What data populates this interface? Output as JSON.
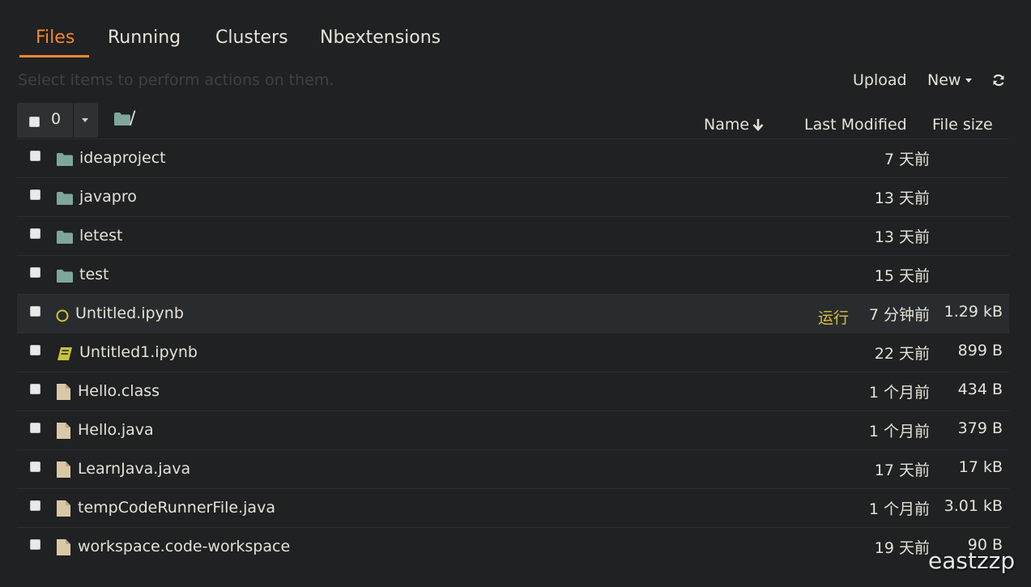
{
  "tabs": [
    {
      "label": "Files"
    },
    {
      "label": "Running"
    },
    {
      "label": "Clusters"
    },
    {
      "label": "Nbextensions"
    }
  ],
  "toolbar": {
    "hint": "Select items to perform actions on them.",
    "upload_label": "Upload",
    "new_label": "New"
  },
  "selector": {
    "count": "0"
  },
  "breadcrumb": {
    "path": "/"
  },
  "columns": {
    "name": "Name",
    "last_modified": "Last Modified",
    "file_size": "File size"
  },
  "rows": [
    {
      "name": "ideaproject",
      "type": "folder",
      "modified": "7 天前",
      "size": "",
      "running": ""
    },
    {
      "name": "javapro",
      "type": "folder",
      "modified": "13 天前",
      "size": "",
      "running": ""
    },
    {
      "name": "letest",
      "type": "folder",
      "modified": "13 天前",
      "size": "",
      "running": ""
    },
    {
      "name": "test",
      "type": "folder",
      "modified": "15 天前",
      "size": "",
      "running": ""
    },
    {
      "name": "Untitled.ipynb",
      "type": "notebook-running",
      "modified": "7 分钟前",
      "size": "1.29 kB",
      "running": "运行"
    },
    {
      "name": "Untitled1.ipynb",
      "type": "notebook",
      "modified": "22 天前",
      "size": "899 B",
      "running": ""
    },
    {
      "name": "Hello.class",
      "type": "file",
      "modified": "1 个月前",
      "size": "434 B",
      "running": ""
    },
    {
      "name": "Hello.java",
      "type": "file",
      "modified": "1 个月前",
      "size": "379 B",
      "running": ""
    },
    {
      "name": "LearnJava.java",
      "type": "file",
      "modified": "17 天前",
      "size": "17 kB",
      "running": ""
    },
    {
      "name": "tempCodeRunnerFile.java",
      "type": "file",
      "modified": "1 个月前",
      "size": "3.01 kB",
      "running": ""
    },
    {
      "name": "workspace.code-workspace",
      "type": "file",
      "modified": "19 天前",
      "size": "90 B",
      "running": ""
    }
  ],
  "icons": {
    "folder": "folder-icon",
    "notebook": "book-icon",
    "notebook-running": "circle-icon",
    "file": "file-icon",
    "refresh": "refresh-icon",
    "sort": "arrow-down-icon"
  },
  "colors": {
    "background": "#1f2122",
    "accent": "#f2872c",
    "folder": "#7fa69c",
    "running": "#d6c03a",
    "file": "#d9c7a7"
  },
  "watermark": "eastzzp"
}
